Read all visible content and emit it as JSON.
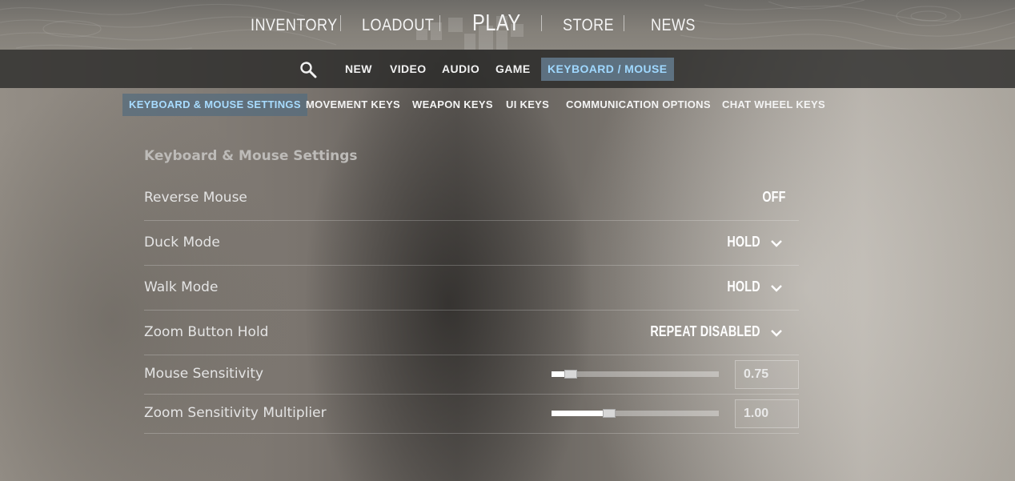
{
  "top_nav": {
    "items": [
      {
        "label": "INVENTORY"
      },
      {
        "label": "LOADOUT"
      },
      {
        "label": "PLAY"
      },
      {
        "label": "STORE"
      },
      {
        "label": "NEWS"
      }
    ]
  },
  "settings_nav": {
    "search_icon": "magnifier-icon",
    "items": [
      {
        "label": "NEW"
      },
      {
        "label": "VIDEO"
      },
      {
        "label": "AUDIO"
      },
      {
        "label": "GAME"
      },
      {
        "label": "KEYBOARD / MOUSE",
        "active": true
      }
    ]
  },
  "category_tabs": [
    {
      "label": "KEYBOARD & MOUSE SETTINGS",
      "active": true
    },
    {
      "label": "MOVEMENT KEYS"
    },
    {
      "label": "WEAPON KEYS"
    },
    {
      "label": "UI KEYS"
    },
    {
      "label": "COMMUNICATION OPTIONS"
    },
    {
      "label": "CHAT WHEEL KEYS"
    }
  ],
  "section": {
    "title": "Keyboard & Mouse Settings",
    "rows": [
      {
        "label": "Reverse Mouse",
        "value": "OFF",
        "type": "toggle"
      },
      {
        "label": "Duck Mode",
        "value": "HOLD",
        "type": "dropdown"
      },
      {
        "label": "Walk Mode",
        "value": "HOLD",
        "type": "dropdown"
      },
      {
        "label": "Zoom Button Hold",
        "value": "REPEAT DISABLED",
        "type": "dropdown"
      },
      {
        "label": "Mouse Sensitivity",
        "value": "0.75",
        "type": "slider",
        "slider_fraction": 0.115
      },
      {
        "label": "Zoom Sensitivity Multiplier",
        "value": "1.00",
        "type": "slider",
        "slider_fraction": 0.345
      }
    ]
  },
  "colors": {
    "active_tab_text": "#9fd8ff",
    "active_tab_bg": "#668094"
  }
}
